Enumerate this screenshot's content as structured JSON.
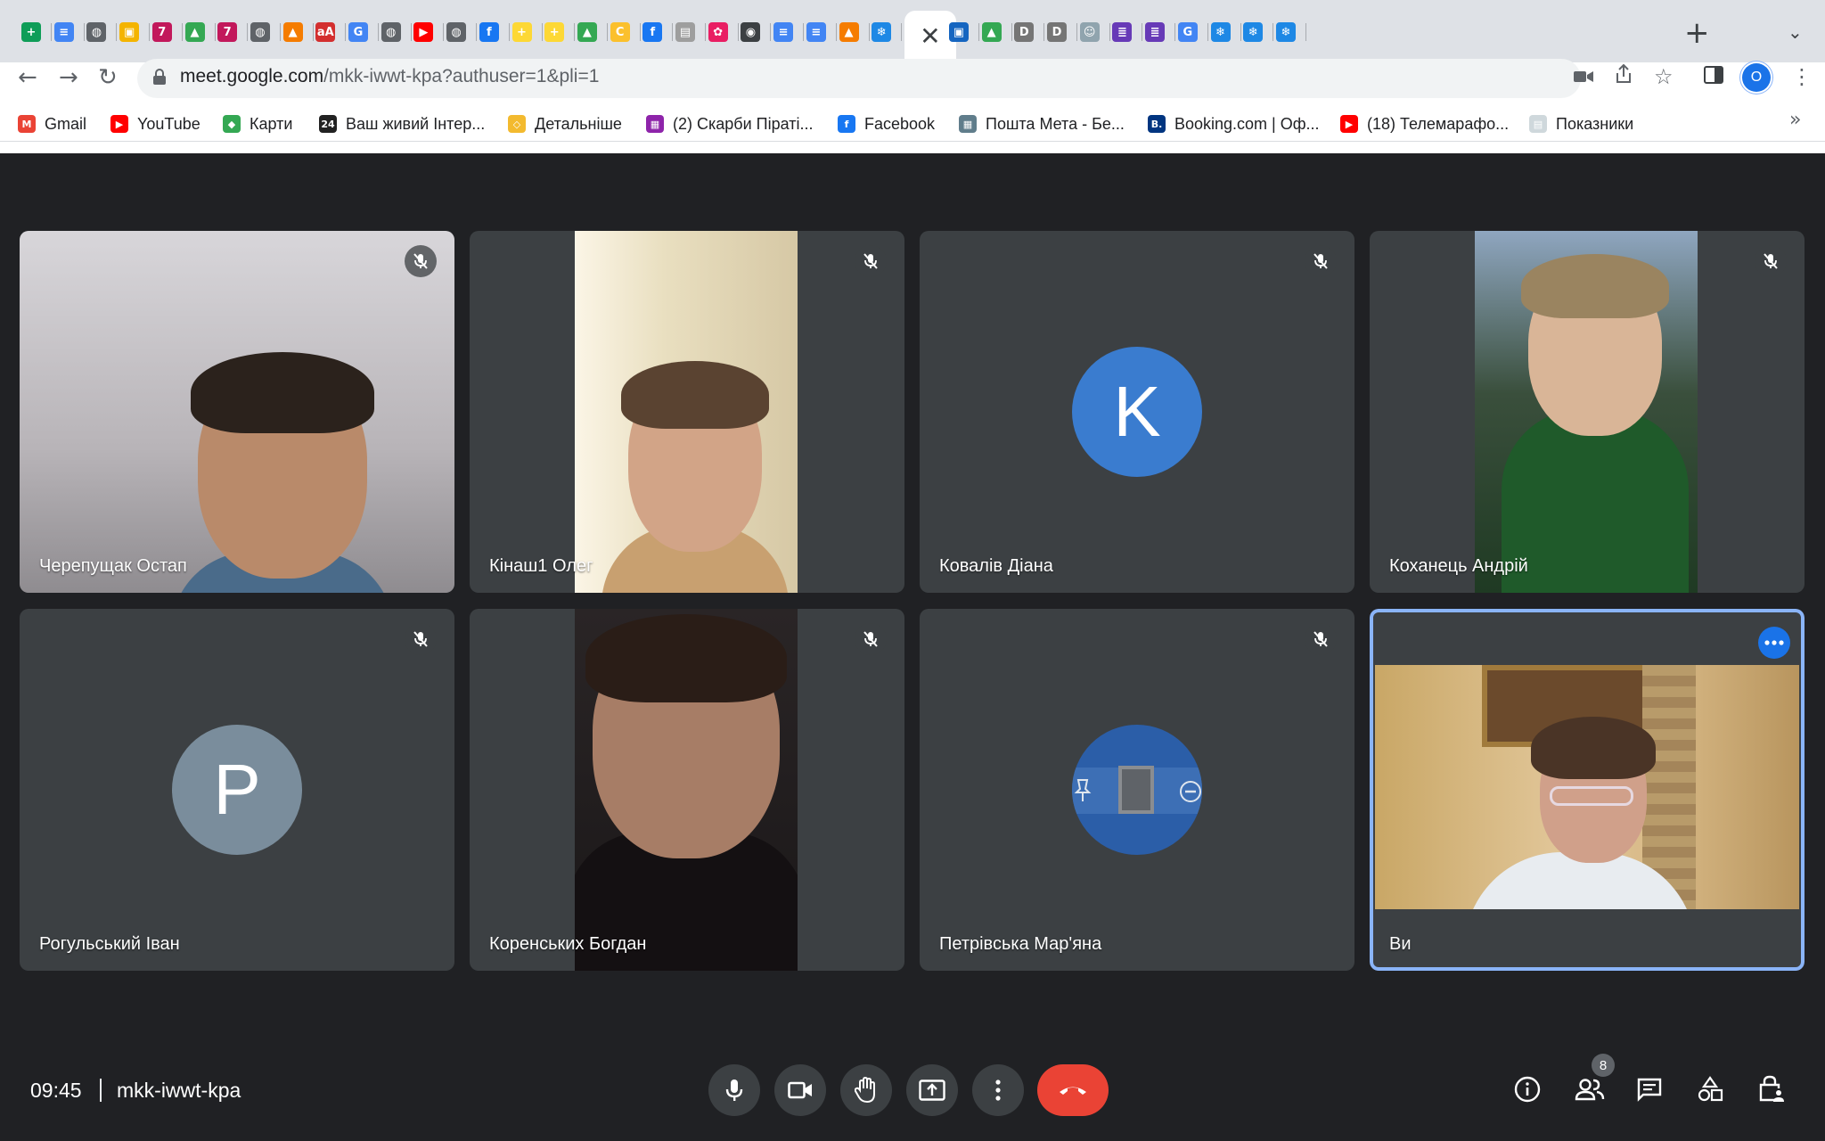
{
  "browser": {
    "tabs": [
      {
        "icon": "sheets-icon",
        "color": "#0f9d58",
        "glyph": "+"
      },
      {
        "icon": "docs-icon",
        "color": "#4285f4",
        "glyph": "≡"
      },
      {
        "icon": "globe-icon",
        "color": "#5f6368",
        "glyph": "◍"
      },
      {
        "icon": "classroom-icon",
        "color": "#f4b400",
        "glyph": "▣"
      },
      {
        "icon": "seven-icon",
        "color": "#c2185b",
        "glyph": "7"
      },
      {
        "icon": "drive-icon",
        "color": "#34a853",
        "glyph": "▲"
      },
      {
        "icon": "seven-icon",
        "color": "#c2185b",
        "glyph": "7"
      },
      {
        "icon": "globe-icon",
        "color": "#5f6368",
        "glyph": "◍"
      },
      {
        "icon": "vlc-icon",
        "color": "#f57c00",
        "glyph": "▲"
      },
      {
        "icon": "dictionary-icon",
        "color": "#d32f2f",
        "glyph": "aA"
      },
      {
        "icon": "google-icon",
        "color": "#4285f4",
        "glyph": "G"
      },
      {
        "icon": "globe-icon",
        "color": "#5f6368",
        "glyph": "◍"
      },
      {
        "icon": "youtube-icon",
        "color": "#ff0000",
        "glyph": "▶"
      },
      {
        "icon": "globe-icon",
        "color": "#5f6368",
        "glyph": "◍"
      },
      {
        "icon": "facebook-icon",
        "color": "#1877f2",
        "glyph": "f"
      },
      {
        "icon": "plus-circle-icon",
        "color": "#fdd835",
        "glyph": "+"
      },
      {
        "icon": "plus-circle-icon",
        "color": "#fdd835",
        "glyph": "+"
      },
      {
        "icon": "drive-icon",
        "color": "#34a853",
        "glyph": "▲"
      },
      {
        "icon": "c-icon",
        "color": "#fbc02d",
        "glyph": "C"
      },
      {
        "icon": "facebook-icon",
        "color": "#1877f2",
        "glyph": "f"
      },
      {
        "icon": "book-icon",
        "color": "#9e9e9e",
        "glyph": "▤"
      },
      {
        "icon": "pink-icon",
        "color": "#e91e63",
        "glyph": "✿"
      },
      {
        "icon": "chrome-icon",
        "color": "#3c4043",
        "glyph": "◉"
      },
      {
        "icon": "docs-icon",
        "color": "#4285f4",
        "glyph": "≡"
      },
      {
        "icon": "docs-icon",
        "color": "#4285f4",
        "glyph": "≡"
      },
      {
        "icon": "vlc-icon",
        "color": "#f57c00",
        "glyph": "▲"
      },
      {
        "icon": "snowflake-icon",
        "color": "#1e88e5",
        "glyph": "❄"
      },
      {
        "icon": "contact-icon",
        "color": "#1565c0",
        "glyph": "▣"
      },
      {
        "icon": "drive-icon",
        "color": "#34a853",
        "glyph": "▲"
      },
      {
        "icon": "d-icon",
        "color": "#757575",
        "glyph": "D"
      },
      {
        "icon": "d-icon",
        "color": "#757575",
        "glyph": "D"
      },
      {
        "icon": "mask-icon",
        "color": "#90a4ae",
        "glyph": "☺"
      },
      {
        "icon": "forms-icon",
        "color": "#673ab7",
        "glyph": "≣"
      },
      {
        "icon": "forms-icon",
        "color": "#673ab7",
        "glyph": "≣"
      },
      {
        "icon": "google-icon",
        "color": "#4285f4",
        "glyph": "G"
      },
      {
        "icon": "snowflake-icon",
        "color": "#1e88e5",
        "glyph": "❄"
      },
      {
        "icon": "snowflake-icon",
        "color": "#1e88e5",
        "glyph": "❄"
      },
      {
        "icon": "snowflake-icon",
        "color": "#1e88e5",
        "glyph": "❄"
      }
    ],
    "active_tab_close": "✕",
    "new_tab": "+",
    "tab_search": "⌄",
    "url_host": "meet.google.com",
    "url_path": "/mkk-iwwt-kpa?authuser=1&pli=1",
    "profile_initial": "O",
    "bookmarks": [
      {
        "label": "Gmail",
        "icon": "gmail-icon",
        "color": "#ea4335",
        "glyph": "M"
      },
      {
        "label": "YouTube",
        "icon": "youtube-icon",
        "color": "#ff0000",
        "glyph": "▶"
      },
      {
        "label": "Карти",
        "icon": "maps-icon",
        "color": "#34a853",
        "glyph": "◆"
      },
      {
        "label": "Ваш живий Інтер...",
        "icon": "channel24-icon",
        "color": "#222222",
        "glyph": "24"
      },
      {
        "label": "Детальніше",
        "icon": "binance-icon",
        "color": "#f3ba2f",
        "glyph": "◇"
      },
      {
        "label": "(2) Скарби Піраті...",
        "icon": "puzzle-icon",
        "color": "#8e24aa",
        "glyph": "▦"
      },
      {
        "label": "Facebook",
        "icon": "facebook-icon",
        "color": "#1877f2",
        "glyph": "f"
      },
      {
        "label": "Пошта Мета - Бе...",
        "icon": "meta-mail-icon",
        "color": "#607d8b",
        "glyph": "▦"
      },
      {
        "label": "Booking.com | Оф...",
        "icon": "booking-icon",
        "color": "#003580",
        "glyph": "B."
      },
      {
        "label": "(18) Телемарафо...",
        "icon": "youtube-icon",
        "color": "#ff0000",
        "glyph": "▶"
      },
      {
        "label": "Показники",
        "icon": "doc-icon",
        "color": "#cfd8dc",
        "glyph": "▤"
      }
    ],
    "bookmarks_more": "»"
  },
  "meeting": {
    "participants": [
      {
        "name": "Черепущак Остап",
        "type": "video",
        "muted": true
      },
      {
        "name": "Кінаш1 Олег",
        "type": "video",
        "muted": true
      },
      {
        "name": "Ковалів Діана",
        "type": "avatar",
        "initial": "K",
        "avatar_color": "#3a7ccf",
        "muted": true
      },
      {
        "name": "Коханець Андрій",
        "type": "video",
        "muted": true
      },
      {
        "name": "Рогульський Іван",
        "type": "avatar",
        "initial": "P",
        "avatar_color": "#7a8d9c",
        "muted": true
      },
      {
        "name": "Коренських Богдан",
        "type": "video",
        "muted": true
      },
      {
        "name": "Петрівська Мар'яна",
        "type": "avatar-hover",
        "avatar_color": "#2b5ea8",
        "muted": true
      },
      {
        "name": "Ви",
        "type": "self",
        "muted": false
      }
    ],
    "time": "09:45",
    "code": "mkk-iwwt-kpa",
    "participant_count": "8",
    "colors": {
      "accent": "#8ab4f8",
      "hangup": "#ea4335",
      "control_bg": "#3c4043",
      "stage_bg": "#202124"
    }
  }
}
